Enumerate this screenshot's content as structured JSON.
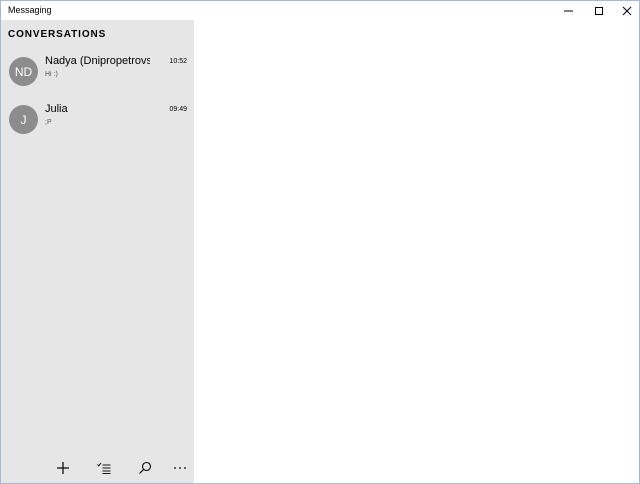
{
  "window": {
    "title": "Messaging",
    "controls": {
      "minimize_icon": "minimize-icon",
      "maximize_icon": "maximize-icon",
      "close_icon": "close-icon"
    }
  },
  "sidebar": {
    "heading": "CONVERSATIONS",
    "background": "#e6e6e6",
    "conversations": [
      {
        "initials": "ND",
        "name": "Nadya (Dnipropetrovs",
        "time": "10:52",
        "preview": "Hi :)",
        "avatar_color": "#8c8c8c"
      },
      {
        "initials": "J",
        "name": "Julia",
        "time": "09:49",
        "preview": ";P",
        "avatar_color": "#8c8c8c"
      }
    ],
    "toolbar": {
      "icons": [
        "add-icon",
        "select-list-icon",
        "search-icon",
        "more-icon"
      ]
    }
  },
  "colors": {
    "window_border": "#a9b8d6",
    "content_bg": "#ffffff"
  }
}
